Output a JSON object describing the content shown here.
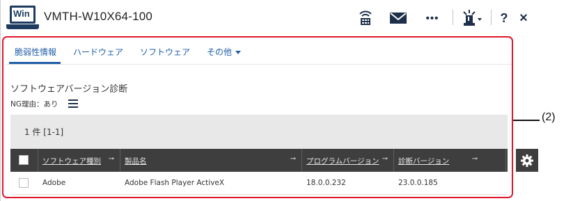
{
  "window": {
    "app_badge": "Win",
    "title": "VMTH-W10X64-100"
  },
  "toolbar": {
    "items": [
      {
        "name": "network-icon"
      },
      {
        "name": "mail-icon"
      },
      {
        "name": "more-icon",
        "label": "•••"
      },
      {
        "name": "alert-lamp-icon"
      },
      {
        "name": "help-icon",
        "label": "?"
      },
      {
        "name": "close-icon",
        "label": "×"
      }
    ]
  },
  "tabs": [
    {
      "label": "脆弱性情報",
      "active": true
    },
    {
      "label": "ハードウェア",
      "active": false
    },
    {
      "label": "ソフトウェア",
      "active": false
    },
    {
      "label": "その他",
      "active": false,
      "dropdown": true
    }
  ],
  "section": {
    "title": "ソフトウェアバージョン診断",
    "ng_label": "NG理由：あり"
  },
  "results": {
    "count_text": "1 件  [1-1]"
  },
  "table": {
    "columns": [
      {
        "label": "ソフトウェア種別"
      },
      {
        "label": "製品名"
      },
      {
        "label": "プログラムバージョン"
      },
      {
        "label": "診断バージョン"
      }
    ],
    "rows": [
      {
        "type": "Adobe",
        "product": "Adobe Flash Player ActiveX",
        "program_version": "18.0.0.232",
        "diag_version": "23.0.0.185"
      }
    ]
  },
  "annotation": {
    "label": "(2)",
    "color": "#e0162b"
  },
  "colors": {
    "accent": "#1f5ea8",
    "header_dark": "#3e3e3e",
    "icon_navy": "#1d2f4a"
  }
}
